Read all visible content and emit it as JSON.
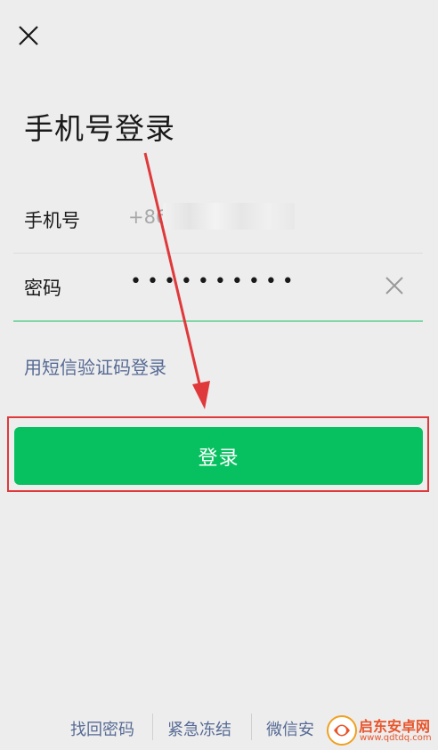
{
  "header": {
    "close_icon": "close-icon"
  },
  "page": {
    "title": "手机号登录"
  },
  "form": {
    "phone_label": "手机号",
    "phone_value": "+86",
    "password_label": "密码",
    "password_value": "••••••••••",
    "clear_icon": "clear-icon"
  },
  "links": {
    "sms_login": "用短信验证码登录"
  },
  "actions": {
    "login_label": "登录"
  },
  "footer": {
    "items": [
      "找回密码",
      "紧急冻结",
      "微信安"
    ]
  },
  "watermark": {
    "brand": "启东安卓网",
    "url": "www.qdtdq.com"
  },
  "colors": {
    "primary": "#07c160",
    "link": "#576b95",
    "annotation": "#e0393b",
    "background": "#ededed"
  }
}
